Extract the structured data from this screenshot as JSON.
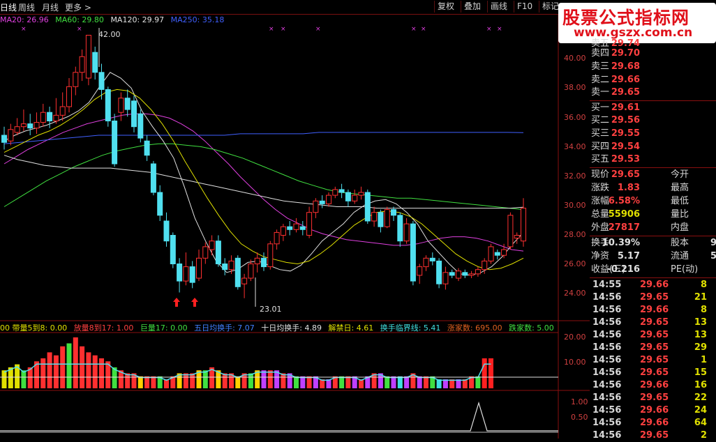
{
  "menu": {
    "items": [
      "日线",
      "周线",
      "月线",
      "更多 >"
    ],
    "right_buttons": [
      "复权",
      "叠加",
      "画线",
      "F10",
      "标记"
    ]
  },
  "ma_legend": [
    {
      "label": "MA20: 26.96",
      "color": "#e040e0"
    },
    {
      "label": "MA60: 29.80",
      "color": "#40e040"
    },
    {
      "label": "MA120: 29.97",
      "color": "#e0e0e0"
    },
    {
      "label": "MA250: 35.18",
      "color": "#4060ff"
    }
  ],
  "chart_annotations": {
    "high": "42.00",
    "low": "23.01"
  },
  "price_axis": [
    "40.00",
    "38.00",
    "36.00",
    "34.00",
    "32.00",
    "30.00",
    "28.00",
    "26.00",
    "24.00"
  ],
  "vol_axis": [
    "20.00",
    "10.00"
  ],
  "ind_axis": [
    "1.00",
    "0.50"
  ],
  "indicator_legend": [
    {
      "label": "00 带量5到8: 0.00",
      "color": "#e0e000"
    },
    {
      "label": "放量8到17: 1.00",
      "color": "#ff4040"
    },
    {
      "label": "巨量17: 0.00",
      "color": "#40e040"
    },
    {
      "label": "五日均换手: 7.07",
      "color": "#4080ff"
    },
    {
      "label": "十日均换手: 4.89",
      "color": "#e0e0e0"
    },
    {
      "label": "解禁日: 4.61",
      "color": "#e0e000"
    },
    {
      "label": "换手临界线: 5.41",
      "color": "#40e0e0"
    },
    {
      "label": "涨家数: 695.00",
      "color": "#e06020"
    },
    {
      "label": "跌家数: 5.00",
      "color": "#40e040"
    }
  ],
  "watermark": {
    "title": "股票公式指标网",
    "url": "www.gszx.com.cn"
  },
  "order_book": {
    "sell": [
      {
        "label": "卖五",
        "price": "29.74"
      },
      {
        "label": "卖四",
        "price": "29.70"
      },
      {
        "label": "卖三",
        "price": "29.68"
      },
      {
        "label": "卖二",
        "price": "29.66"
      },
      {
        "label": "卖一",
        "price": "29.65"
      }
    ],
    "buy": [
      {
        "label": "买一",
        "price": "29.61"
      },
      {
        "label": "买二",
        "price": "29.56"
      },
      {
        "label": "买三",
        "price": "29.55"
      },
      {
        "label": "买四",
        "price": "29.54"
      },
      {
        "label": "买五",
        "price": "29.53"
      }
    ]
  },
  "quote": [
    {
      "l1": "现价",
      "v1": "29.65",
      "l2": "今开",
      "v1color": "#ff4040"
    },
    {
      "l1": "涨跌",
      "v1": "1.83",
      "l2": "最高",
      "v1color": "#ff4040"
    },
    {
      "l1": "涨幅",
      "v1": "6.58%",
      "l2": "最低",
      "v1color": "#ff4040"
    },
    {
      "l1": "总量",
      "v1": "55906",
      "l2": "量比",
      "v1color": "#e0e000"
    },
    {
      "l1": "外盘",
      "v1": "27817",
      "l2": "内盘",
      "v1color": "#ff4040"
    }
  ],
  "quote2": [
    {
      "l1": "换手",
      "v1": "10.39%",
      "l2": "股本",
      "v2": "9"
    },
    {
      "l1": "净资",
      "v1": "5.17",
      "l2": "流通",
      "v2": "5"
    },
    {
      "l1": "收益(三)",
      "v1": "-0.216",
      "l2": "PE(动)",
      "v2": ""
    }
  ],
  "ticks": [
    {
      "time": "14:55",
      "price": "29.66",
      "vol": "8"
    },
    {
      "time": "14:56",
      "price": "29.65",
      "vol": "21"
    },
    {
      "time": "14:56",
      "price": "29.66",
      "vol": "8"
    },
    {
      "time": "14:56",
      "price": "29.65",
      "vol": "13"
    },
    {
      "time": "14:56",
      "price": "29.65",
      "vol": "13"
    },
    {
      "time": "14:56",
      "price": "29.65",
      "vol": "29"
    },
    {
      "time": "14:56",
      "price": "29.65",
      "vol": "1"
    },
    {
      "time": "14:56",
      "price": "29.65",
      "vol": "15"
    },
    {
      "time": "14:56",
      "price": "29.66",
      "vol": "16"
    },
    {
      "time": "14:56",
      "price": "29.65",
      "vol": "22"
    },
    {
      "time": "14:56",
      "price": "29.66",
      "vol": "24"
    },
    {
      "time": "14:56",
      "price": "29.66",
      "vol": "64"
    },
    {
      "time": "14:56",
      "price": "29.65",
      "vol": "2"
    }
  ],
  "chart_data": {
    "type": "candlestick",
    "ylim": [
      23,
      43
    ],
    "candles": [
      [
        35.0,
        34.5,
        35.6,
        34.0
      ],
      [
        34.6,
        35.4,
        35.8,
        34.3
      ],
      [
        35.2,
        35.6,
        36.2,
        35.0
      ],
      [
        35.6,
        35.8,
        36.8,
        35.3
      ],
      [
        35.8,
        35.5,
        36.5,
        35.0
      ],
      [
        35.5,
        35.9,
        36.6,
        35.1
      ],
      [
        35.9,
        36.6,
        37.2,
        35.6
      ],
      [
        36.6,
        36.0,
        37.0,
        35.5
      ],
      [
        36.0,
        36.4,
        37.6,
        35.8
      ],
      [
        36.4,
        37.0,
        38.0,
        36.0
      ],
      [
        37.0,
        38.4,
        39.0,
        36.6
      ],
      [
        38.4,
        39.4,
        39.8,
        37.8
      ],
      [
        39.4,
        40.5,
        41.0,
        38.8
      ],
      [
        39.0,
        42.0,
        42.0,
        38.5
      ],
      [
        40.8,
        39.4,
        41.2,
        38.9
      ],
      [
        39.4,
        38.2,
        40.0,
        37.5
      ],
      [
        38.2,
        36.0,
        38.4,
        35.6
      ],
      [
        36.0,
        33.0,
        36.5,
        32.8
      ],
      [
        36.6,
        37.6,
        38.0,
        36.0
      ],
      [
        37.6,
        36.8,
        38.2,
        36.3
      ],
      [
        37.4,
        35.6,
        37.8,
        35.2
      ],
      [
        36.5,
        34.8,
        36.8,
        34.5
      ],
      [
        34.6,
        33.6,
        35.0,
        33.2
      ],
      [
        33.0,
        31.0,
        33.2,
        30.8
      ],
      [
        31.0,
        29.4,
        31.5,
        29.0
      ],
      [
        29.0,
        27.6,
        29.6,
        27.2
      ],
      [
        28.0,
        26.0,
        28.2,
        25.7
      ],
      [
        26.0,
        24.8,
        26.4,
        24.0
      ],
      [
        24.8,
        25.8,
        26.8,
        24.5
      ],
      [
        25.8,
        24.7,
        26.2,
        24.3
      ],
      [
        25.0,
        26.4,
        27.0,
        24.8
      ],
      [
        26.4,
        27.2,
        27.5,
        26.0
      ],
      [
        27.0,
        27.6,
        28.0,
        26.6
      ],
      [
        27.6,
        26.0,
        28.0,
        25.8
      ],
      [
        26.0,
        25.6,
        26.4,
        25.2
      ],
      [
        25.6,
        26.2,
        26.6,
        25.3
      ],
      [
        26.4,
        24.4,
        26.6,
        24.2
      ],
      [
        24.6,
        25.0,
        25.3,
        23.6
      ],
      [
        25.0,
        26.0,
        26.3,
        24.8
      ],
      [
        26.0,
        26.4,
        26.8,
        25.4
      ],
      [
        26.4,
        25.8,
        26.8,
        25.5
      ],
      [
        25.8,
        27.4,
        27.6,
        25.6
      ],
      [
        27.4,
        28.2,
        28.4,
        27.0
      ],
      [
        28.0,
        28.6,
        28.8,
        27.6
      ],
      [
        28.6,
        28.4,
        29.0,
        28.0
      ],
      [
        28.4,
        28.8,
        29.2,
        28.2
      ],
      [
        28.6,
        28.4,
        29.0,
        28.0
      ],
      [
        28.0,
        29.6,
        30.0,
        27.8
      ],
      [
        29.6,
        30.4,
        30.6,
        29.2
      ],
      [
        30.4,
        30.2,
        30.8,
        29.9
      ],
      [
        30.2,
        30.8,
        31.0,
        30.0
      ],
      [
        30.8,
        31.2,
        31.4,
        30.6
      ],
      [
        31.2,
        31.0,
        31.6,
        30.6
      ],
      [
        31.0,
        30.4,
        31.2,
        30.0
      ],
      [
        30.4,
        30.8,
        31.2,
        30.2
      ],
      [
        30.8,
        31.0,
        31.4,
        30.5
      ],
      [
        31.0,
        29.0,
        31.2,
        28.8
      ],
      [
        29.0,
        29.6,
        30.0,
        28.6
      ],
      [
        29.6,
        28.6,
        29.8,
        28.2
      ],
      [
        28.6,
        29.8,
        30.0,
        28.5
      ],
      [
        29.8,
        29.4,
        30.0,
        29.0
      ],
      [
        29.4,
        27.6,
        29.6,
        27.2
      ],
      [
        27.6,
        28.8,
        29.2,
        27.4
      ],
      [
        28.8,
        24.8,
        29.0,
        24.5
      ],
      [
        25.2,
        25.8,
        26.0,
        24.6
      ],
      [
        25.8,
        26.4,
        26.6,
        25.5
      ],
      [
        26.4,
        26.2,
        26.8,
        25.9
      ],
      [
        26.2,
        24.6,
        26.4,
        24.3
      ],
      [
        24.6,
        25.4,
        25.8,
        24.2
      ],
      [
        25.4,
        25.2,
        25.6,
        25.0
      ],
      [
        25.0,
        25.5,
        25.7,
        24.8
      ],
      [
        25.4,
        25.2,
        25.6,
        25.0
      ],
      [
        25.2,
        25.3,
        25.5,
        25.0
      ],
      [
        25.3,
        25.6,
        25.8,
        25.1
      ],
      [
        25.6,
        26.2,
        26.4,
        25.3
      ],
      [
        26.2,
        27.2,
        27.4,
        26.0
      ],
      [
        26.8,
        26.6,
        27.0,
        26.3
      ],
      [
        26.6,
        27.0,
        27.4,
        26.4
      ],
      [
        27.2,
        29.4,
        29.6,
        27.0
      ],
      [
        27.8,
        28.0,
        28.2,
        27.4
      ],
      [
        27.6,
        29.9,
        30.6,
        27.2
      ]
    ],
    "ma_series": [
      {
        "name": "MA20",
        "color": "#e040e0",
        "values": [
          33.0,
          33.5,
          34.0,
          34.4,
          34.8,
          35.2,
          35.5,
          35.8,
          36.0,
          36.2,
          36.4,
          36.5,
          36.5,
          36.4,
          36.2,
          35.8,
          35.3,
          34.6,
          33.8,
          33.0,
          32.1,
          31.3,
          30.5,
          29.8,
          29.2,
          28.8,
          28.4,
          28.1,
          27.9,
          27.7,
          27.6,
          27.5,
          27.4,
          27.3,
          27.3,
          27.4,
          27.6,
          27.8,
          27.9,
          27.9,
          27.8,
          27.6,
          27.3,
          27.0,
          26.9
        ]
      },
      {
        "name": "MA60",
        "color": "#40e040",
        "values": [
          30.0,
          30.6,
          31.2,
          31.8,
          32.3,
          32.8,
          33.2,
          33.6,
          33.9,
          34.1,
          34.3,
          34.4,
          34.4,
          34.3,
          34.2,
          34.0,
          33.7,
          33.4,
          33.0,
          32.6,
          32.2,
          31.8,
          31.5,
          31.2,
          31.0,
          30.9,
          30.8,
          30.7,
          30.6,
          30.6,
          30.5,
          30.4,
          30.3,
          30.2,
          30.1,
          30.0,
          29.9,
          29.8
        ]
      },
      {
        "name": "MA120",
        "color": "#e0e0e0",
        "values": [
          33.6,
          33.3,
          33.1,
          32.9,
          32.8,
          32.7,
          32.7,
          32.7,
          32.7,
          32.6,
          32.5,
          32.4,
          32.2,
          32.0,
          31.8,
          31.6,
          31.4,
          31.2,
          31.0,
          30.8,
          30.6,
          30.4,
          30.3,
          30.2,
          30.1,
          30.0,
          30.0,
          30.0,
          29.9,
          29.9,
          29.9,
          29.9,
          29.9,
          29.9,
          29.9,
          29.9,
          29.9,
          29.9,
          29.9,
          29.97
        ]
      },
      {
        "name": "MA250",
        "color": "#4060ff",
        "values": [
          34.4,
          34.5,
          34.6,
          34.7,
          34.8,
          34.9,
          35.0,
          35.0,
          35.0,
          35.0,
          35.0,
          35.0,
          35.0,
          35.0,
          35.0,
          35.1,
          35.1,
          35.1,
          35.1,
          35.1,
          35.2,
          35.2,
          35.2,
          35.2,
          35.2,
          35.2,
          35.2,
          35.2,
          35.2,
          35.2,
          35.2,
          35.2,
          35.2,
          35.18
        ]
      },
      {
        "name": "MA5",
        "color": "#e0e0e0",
        "values": [
          34.6,
          35.0,
          35.3,
          35.5,
          35.7,
          36.0,
          36.3,
          36.7,
          37.3,
          38.4,
          39.4,
          39.0,
          38.3,
          36.7,
          35.6,
          34.6,
          33.4,
          31.4,
          29.2,
          27.6,
          26.2,
          25.4,
          25.6,
          26.1,
          26.2,
          25.9,
          25.6,
          25.5,
          25.9,
          26.7,
          27.6,
          28.2,
          28.8,
          29.6,
          30.1,
          30.4,
          30.5,
          30.2,
          29.6,
          28.8,
          27.6,
          26.8,
          26.0,
          25.3,
          25.2,
          25.4,
          25.8,
          26.5,
          27.4,
          28.2
        ]
      },
      {
        "name": "MA10",
        "color": "#e0e000",
        "values": [
          33.8,
          34.2,
          34.6,
          35.0,
          35.3,
          35.7,
          36.2,
          36.8,
          37.5,
          38.0,
          38.2,
          38.1,
          37.6,
          36.8,
          35.8,
          34.6,
          33.2,
          31.9,
          30.6,
          29.4,
          28.3,
          27.4,
          26.9,
          26.5,
          26.3,
          26.1,
          26.0,
          26.2,
          26.7,
          27.3,
          28.0,
          28.7,
          29.2,
          29.6,
          29.7,
          29.6,
          29.3,
          28.8,
          28.1,
          27.4,
          26.7,
          26.2,
          25.8,
          25.6,
          25.7,
          26.0,
          26.4
        ]
      }
    ],
    "volume": [
      6,
      7,
      8,
      6,
      7,
      9,
      10,
      12,
      11,
      14,
      15,
      17,
      14,
      12,
      11,
      10,
      9,
      7,
      6,
      5,
      5,
      4,
      4,
      4,
      4,
      3,
      4,
      5,
      5,
      5,
      6,
      6,
      7,
      6,
      5,
      5,
      4,
      5,
      5,
      6,
      6,
      6,
      6,
      5,
      5,
      4,
      4,
      4,
      4,
      3,
      3,
      4,
      4,
      4,
      4,
      3,
      4,
      5,
      5,
      4,
      4,
      4,
      4,
      5,
      4,
      4,
      4,
      3,
      3,
      3,
      3,
      3,
      4,
      4,
      10,
      10
    ],
    "indicator_peak": 1
  }
}
